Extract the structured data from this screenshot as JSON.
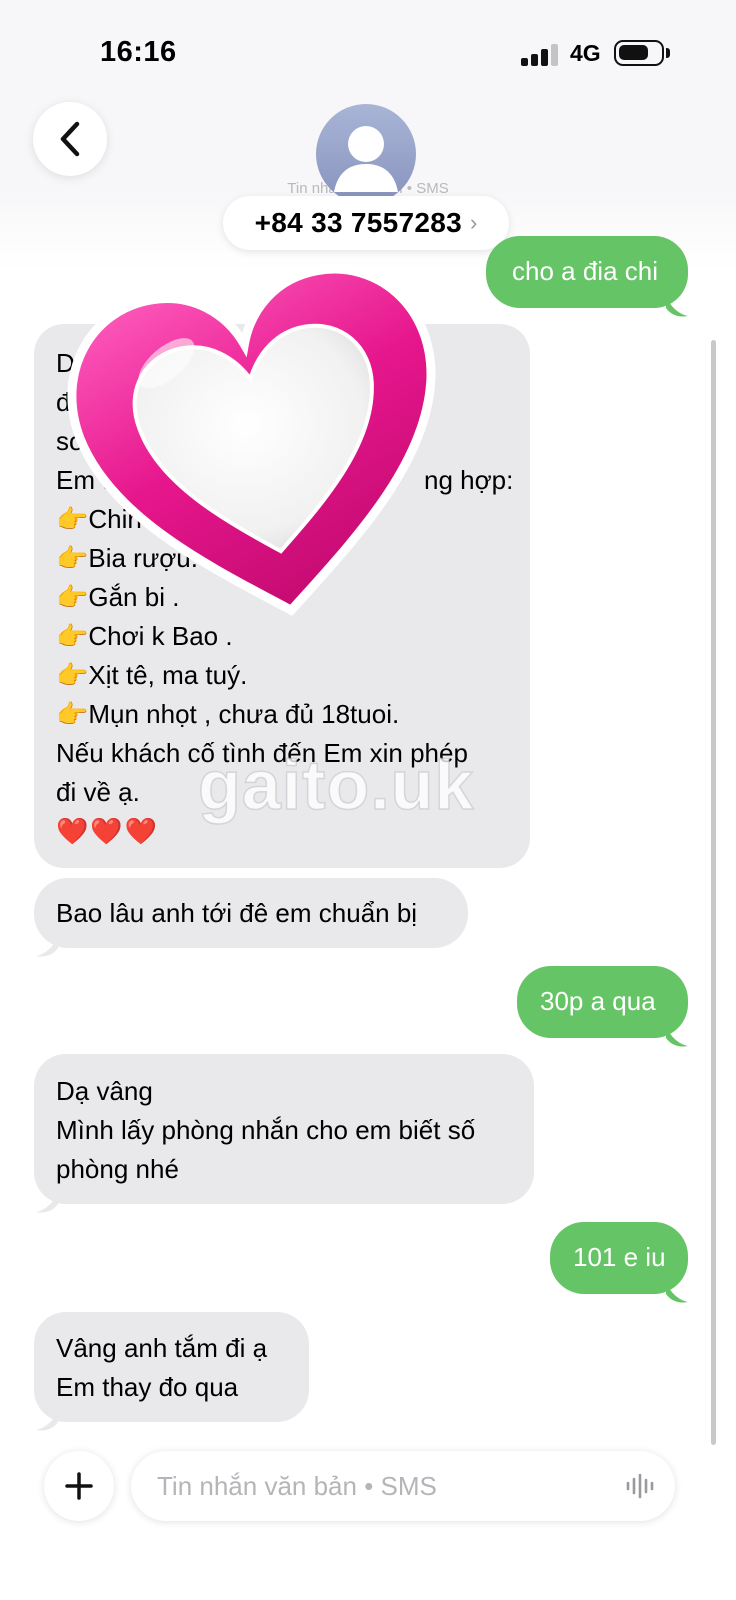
{
  "status_bar": {
    "time": "16:16",
    "network": "4G"
  },
  "header": {
    "back_icon": "chevron-left-icon",
    "avatar_icon": "person-icon",
    "sub_label": "Tin nhắn văn bản • SMS",
    "contact_number": "+84 33 7557283",
    "contact_chevron": "›"
  },
  "messages": [
    {
      "direction": "out",
      "lines": [
        "cho a đia chi"
      ]
    },
    {
      "direction": "in",
      "visible_lines": [
        "Da",
        "đ",
        "so",
        "Em t",
        "ng hợp:",
        "👉Chin",
        "👉Bia rượu.",
        "👉Gắn bi .",
        "👉Chơi k Bao .",
        "👉Xịt tê, ma tuý.",
        "👉Mụn nhọt , chưa đủ 18tuoi.",
        "Nếu khách cố tình đến Em xin phép",
        "đi về ạ.",
        "❤️❤️❤️"
      ]
    },
    {
      "direction": "in",
      "lines": [
        "Bao lâu anh tới đê em chuẩn bị"
      ]
    },
    {
      "direction": "out",
      "lines": [
        "30p a qua"
      ]
    },
    {
      "direction": "in",
      "lines": [
        "Dạ vâng",
        "Mình lấy phòng nhắn cho em biết số",
        "phòng nhé"
      ]
    },
    {
      "direction": "out",
      "lines": [
        "101 e iu"
      ]
    },
    {
      "direction": "in",
      "lines": [
        "Vâng anh tắm đi ạ",
        "Em thay đo qua"
      ]
    }
  ],
  "sticker": {
    "icon": "pink-heart-sticker-icon"
  },
  "watermark": "gaito.uk",
  "composer": {
    "plus_icon": "plus-icon",
    "placeholder": "Tin nhắn văn bản • SMS",
    "mic_icon": "audio-waveform-icon"
  },
  "colors": {
    "outgoing": "#65c466",
    "incoming": "#e9e9eb",
    "heart": "#e6168c"
  }
}
